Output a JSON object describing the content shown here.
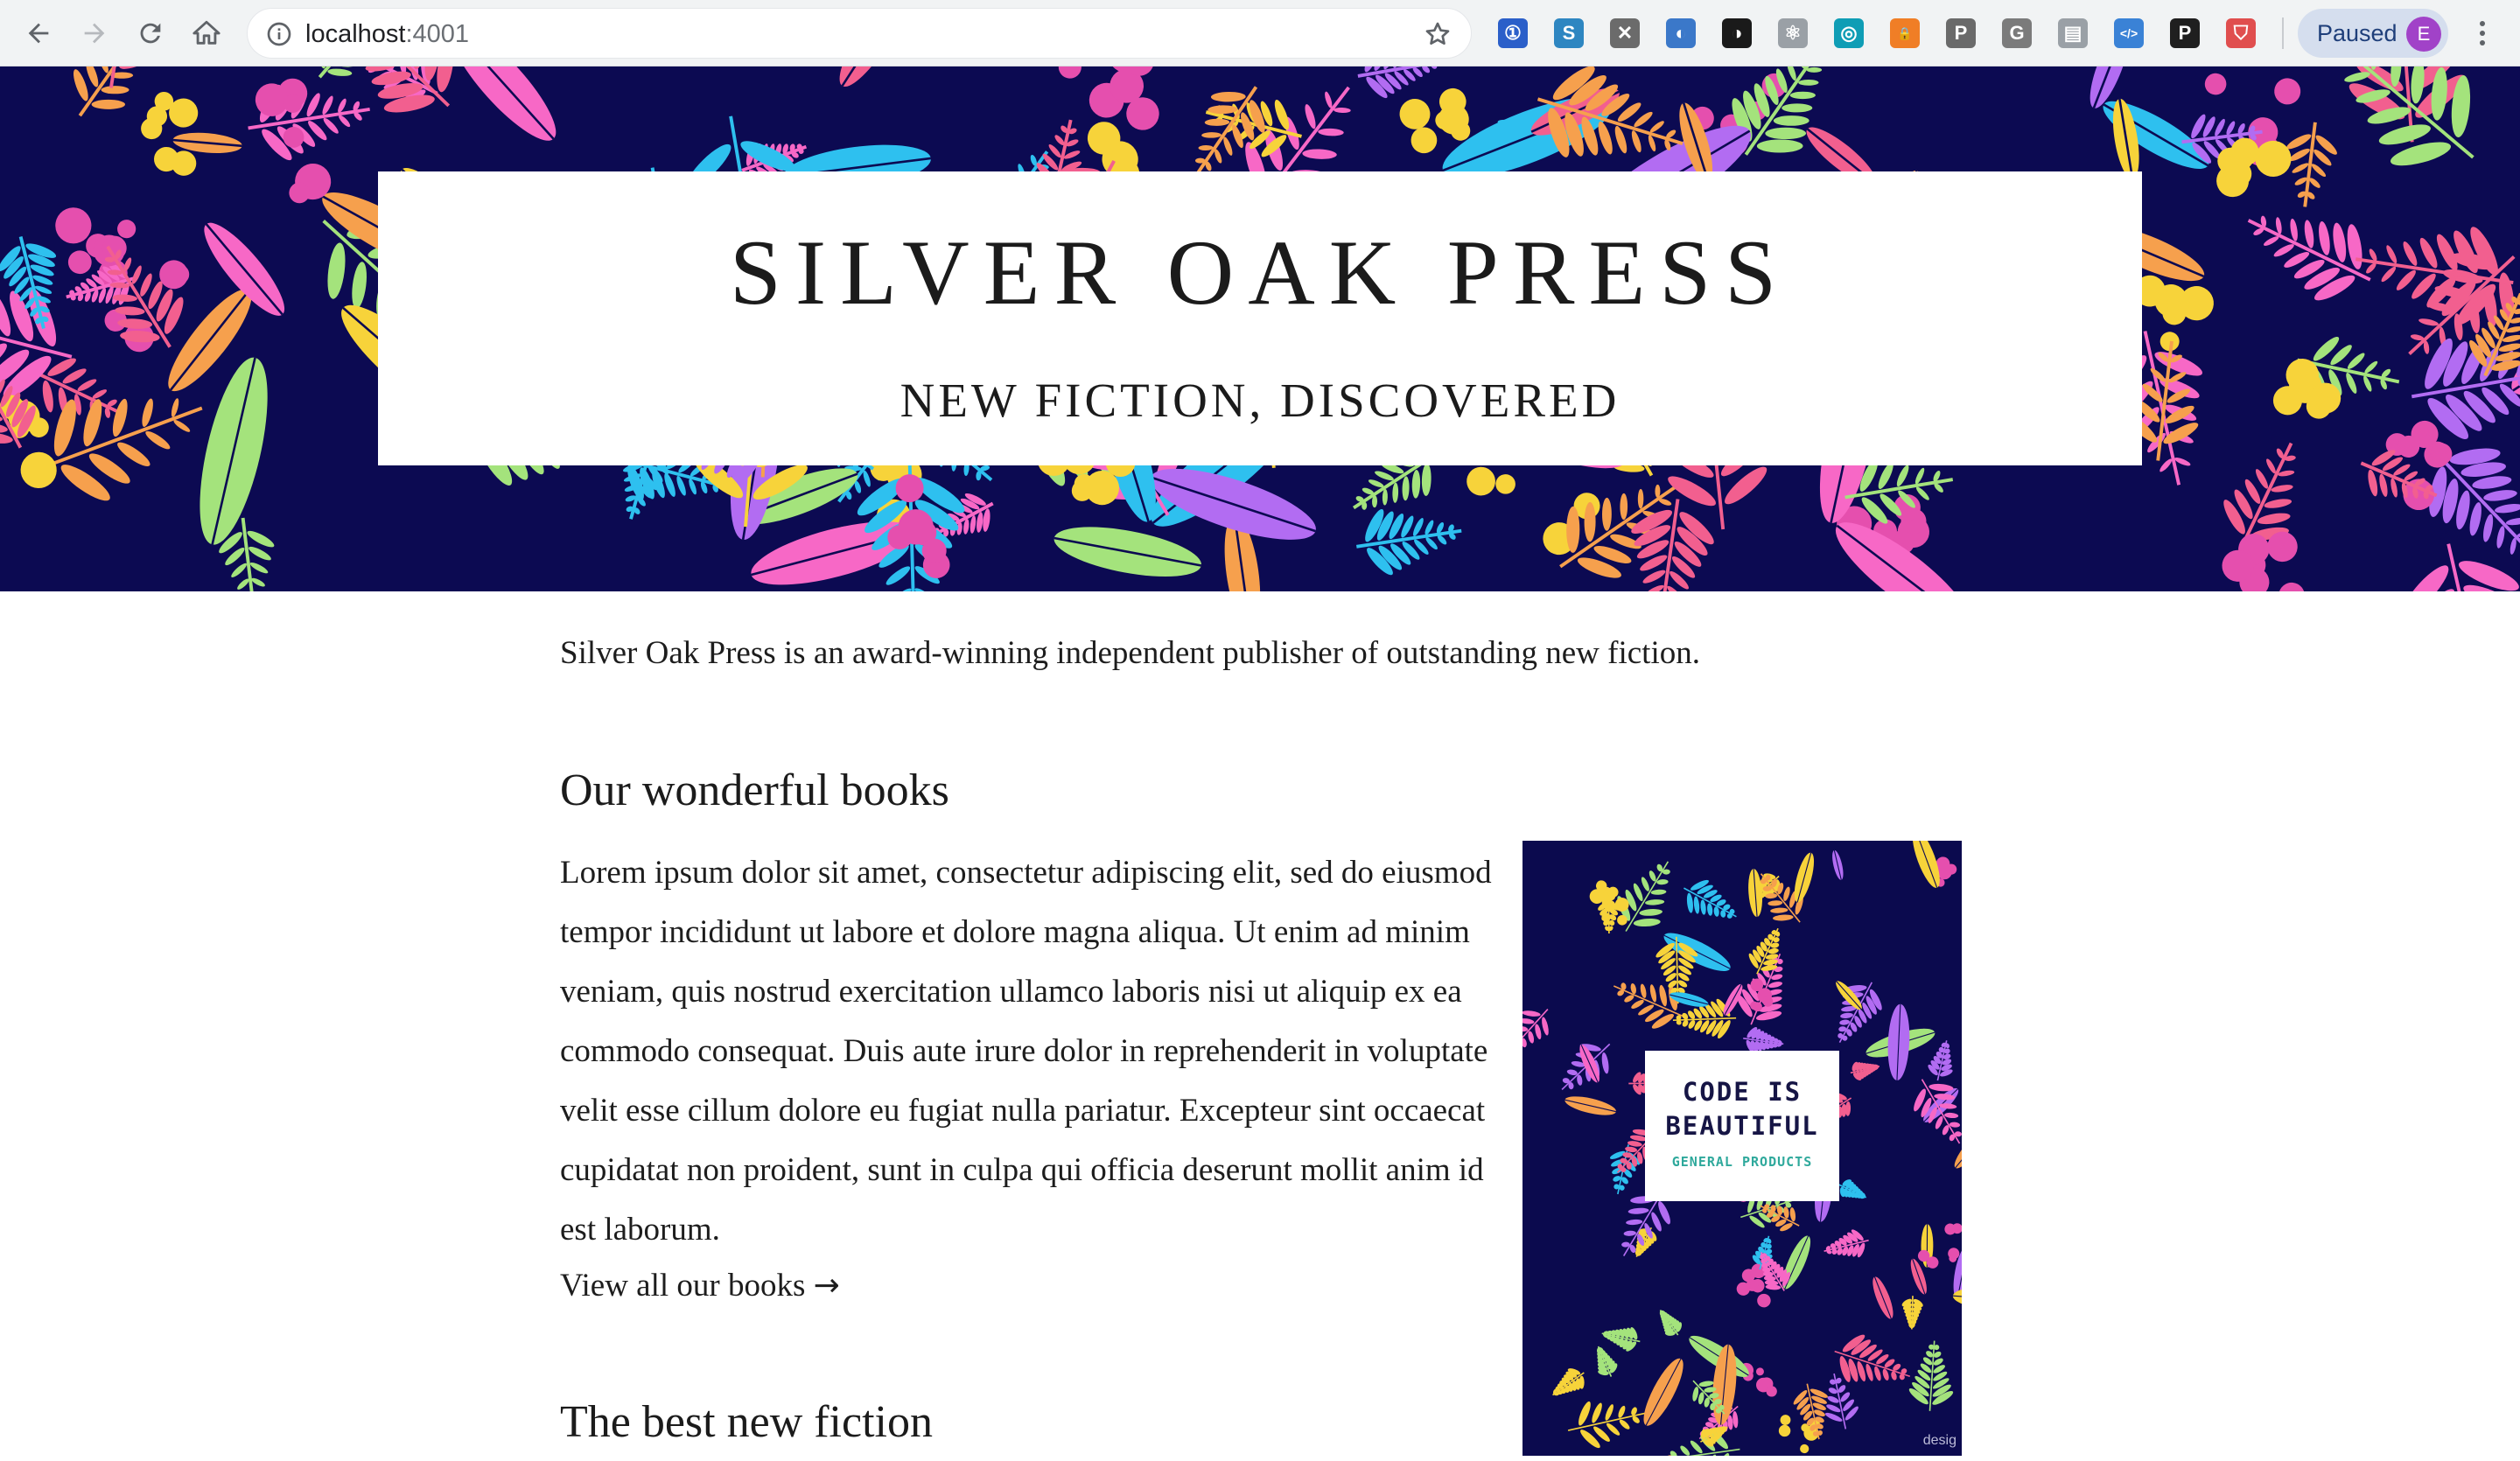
{
  "browser": {
    "url_host": "localhost",
    "url_port": ":4001",
    "profile_status": "Paused",
    "profile_initial": "E",
    "extensions": [
      {
        "icon": "onepassword-icon",
        "color": "#2b5fc9",
        "glyph": "①"
      },
      {
        "icon": "s-extension-icon",
        "color": "#2e86c1",
        "glyph": "S"
      },
      {
        "icon": "x-extension-icon",
        "color": "#6b6b6b",
        "glyph": "✕"
      },
      {
        "icon": "swirl-extension-icon",
        "color": "#3b78c9",
        "glyph": "◐"
      },
      {
        "icon": "dark-mode-icon",
        "color": "#1a1a1a",
        "glyph": "◑"
      },
      {
        "icon": "react-devtools-icon",
        "color": "#9aa0a6",
        "glyph": "⚛"
      },
      {
        "icon": "target-extension-icon",
        "color": "#0f9db5",
        "glyph": "◎"
      },
      {
        "icon": "lock-extension-icon",
        "color": "#f07e26",
        "glyph": "🔒"
      },
      {
        "icon": "p-extension-icon",
        "color": "#6a6a6a",
        "glyph": "P"
      },
      {
        "icon": "g-extension-icon",
        "color": "#7b7b7b",
        "glyph": "G"
      },
      {
        "icon": "layout-extension-icon",
        "color": "#9aa0a6",
        "glyph": "▤"
      },
      {
        "icon": "code-extension-icon",
        "color": "#3a82d6",
        "glyph": "</>"
      },
      {
        "icon": "p-dark-extension-icon",
        "color": "#1f1f1f",
        "glyph": "P"
      },
      {
        "icon": "shield-extension-icon",
        "color": "#e04e4e",
        "glyph": "⛉"
      }
    ]
  },
  "hero": {
    "title": "SILVER OAK PRESS",
    "tagline": "NEW FICTION, DISCOVERED"
  },
  "main": {
    "intro": "Silver Oak Press is an award-winning independent publisher of outstanding new fiction.",
    "section1_heading": "Our wonderful books",
    "section1_body": "Lorem ipsum dolor sit amet, consectetur adipiscing elit, sed do eiusmod tempor incididunt ut labore et dolore magna aliqua. Ut enim ad minim veniam, quis nostrud exercitation ullamco laboris nisi ut aliquip ex ea commodo consequat. Duis aute irure dolor in reprehenderit in voluptate velit esse cillum dolore eu fugiat nulla pariatur. Excepteur sint occaecat cupidatat non proident, sunt in culpa qui officia deserunt mollit anim id est laborum.",
    "view_all_label": "View all our books",
    "view_all_arrow": "→",
    "section2_heading": "The best new fiction"
  },
  "book_cover": {
    "title_line1": "CODE IS",
    "title_line2": "BEAUTIFUL",
    "subtitle": "GENERAL PRODUCTS",
    "credit": "desig"
  },
  "colors": {
    "hero_background": "#0c0a52",
    "cover_subtitle": "#2fa99c",
    "foliage": [
      "#f6a04d",
      "#2ec0ef",
      "#f768c6",
      "#a4e37c",
      "#f7d33a",
      "#b26cf2",
      "#f25f8f",
      "#ffffff"
    ]
  }
}
